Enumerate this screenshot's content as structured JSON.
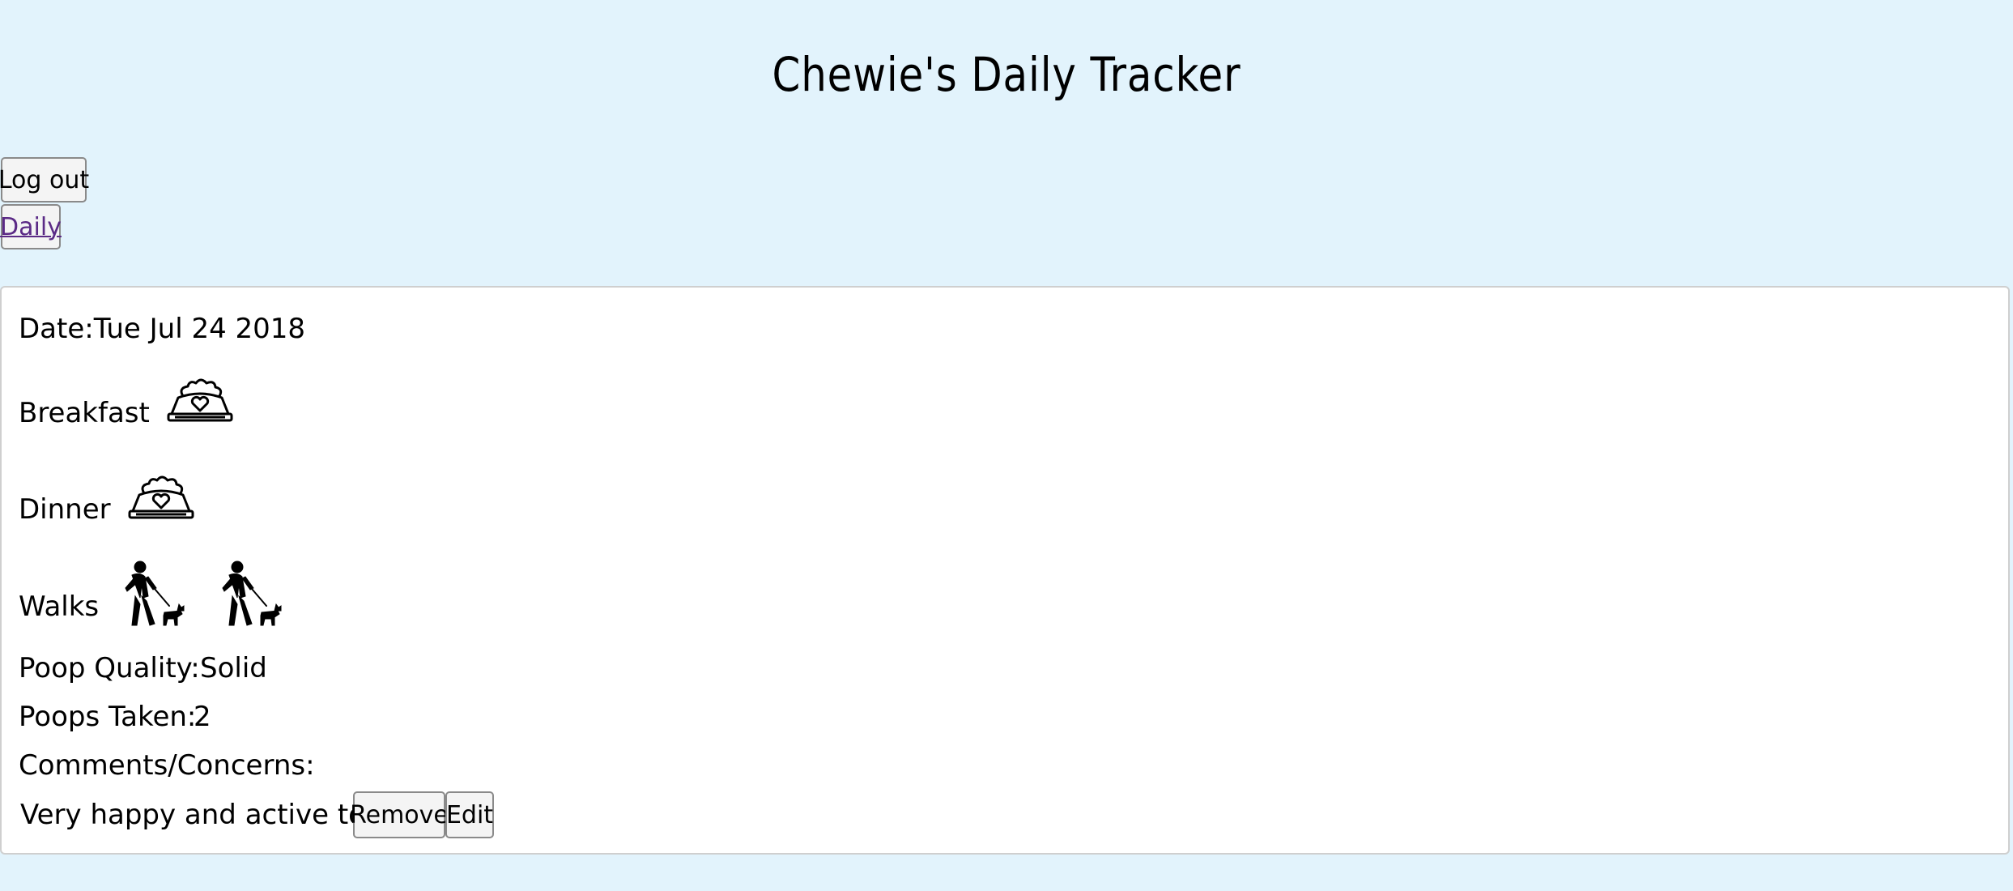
{
  "header": {
    "title": "Chewie's Daily Tracker"
  },
  "nav": {
    "logout_label": "Log out",
    "daily_label": "Daily"
  },
  "entry": {
    "date_label": "Date:",
    "date_value": "Tue Jul 24 2018",
    "breakfast_label": "Breakfast",
    "breakfast_icon": "dog-bowl-icon",
    "dinner_label": "Dinner",
    "dinner_icon": "dog-bowl-icon",
    "walks_label": "Walks",
    "walks_count": 2,
    "walk_icon": "dog-walk-icon",
    "poop_quality_label": "Poop Quality:",
    "poop_quality_value": "Solid",
    "poops_taken_label": "Poops Taken:",
    "poops_taken_value": "2",
    "comments_label": "Comments/Concerns:",
    "comments_value": "Very happy and active today.",
    "remove_label": "Remove",
    "edit_label": "Edit"
  },
  "colors": {
    "page_background": "#e2f3fc",
    "card_background": "#ffffff",
    "link": "#5b2a86"
  }
}
